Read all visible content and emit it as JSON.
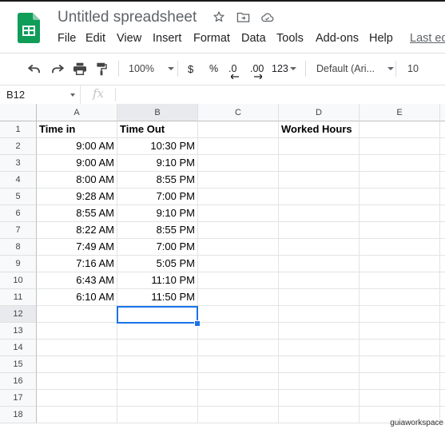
{
  "doc": {
    "title": "Untitled spreadsheet"
  },
  "title_icons": [
    "star-icon",
    "move-to-folder-icon",
    "cloud-status-icon"
  ],
  "menu": {
    "items": [
      "File",
      "Edit",
      "View",
      "Insert",
      "Format",
      "Data",
      "Tools",
      "Add-ons",
      "Help"
    ],
    "last_edit": "Last ed"
  },
  "toolbar": {
    "zoom": "100%",
    "currency": "$",
    "percent": "%",
    "dec_decrease": ".0",
    "dec_increase": ".00",
    "more_formats": "123",
    "font": "Default (Ari...",
    "font_size": "10"
  },
  "formula_bar": {
    "name_box": "B12",
    "fx": "fx",
    "content": ""
  },
  "colors": {
    "accent": "#1a73e8",
    "sheets_green": "#0f9d58"
  },
  "sheet": {
    "columns": [
      "A",
      "B",
      "C",
      "D",
      "E"
    ],
    "rows": [
      "1",
      "2",
      "3",
      "4",
      "5",
      "6",
      "7",
      "8",
      "9",
      "10",
      "11",
      "12",
      "13",
      "14",
      "15",
      "16",
      "17",
      "18"
    ],
    "headers": {
      "a1": "Time in",
      "b1": "Time  Out",
      "d1": "Worked Hours"
    },
    "time_in": [
      "9:00 AM",
      "9:00 AM",
      "8:00 AM",
      "9:28 AM",
      "8:55 AM",
      "8:22 AM",
      "7:49 AM",
      "7:16 AM",
      "6:43 AM",
      "6:10 AM"
    ],
    "time_out": [
      "10:30 PM",
      "9:10 PM",
      "8:55 PM",
      "7:00 PM",
      "9:10 PM",
      "8:55 PM",
      "7:00 PM",
      "5:05 PM",
      "11:10 PM",
      "11:50 PM"
    ]
  },
  "watermark": "guiaworkspace"
}
